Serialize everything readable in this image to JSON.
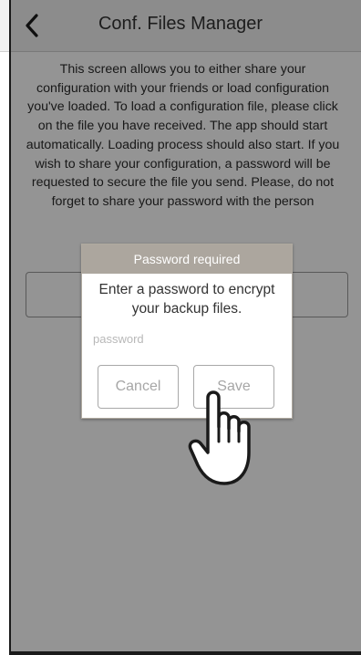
{
  "header": {
    "title": "Conf. Files Manager",
    "back_icon": "chevron-left-icon"
  },
  "description": "This screen allows you to either share your configuration with your friends or load configuration you've loaded. To load a configuration file, please click on the file you have received. The app should start automatically. Loading process should also start. If you wish to share your configuration, a password will be requested to secure the file you send. Please, do not forget to share your password with the person",
  "dialog": {
    "title": "Password required",
    "message": "Enter a password to encrypt your backup files.",
    "input_placeholder": "password",
    "input_value": "",
    "cancel_label": "Cancel",
    "save_label": "Save"
  },
  "cursor_icon": "hand-pointer-icon",
  "colors": {
    "nav_background": "#f2f2f2",
    "dialog_header": "#aca69e",
    "overlay": "rgba(0,0,0,0.42)",
    "button_text": "#a6a6a6"
  }
}
